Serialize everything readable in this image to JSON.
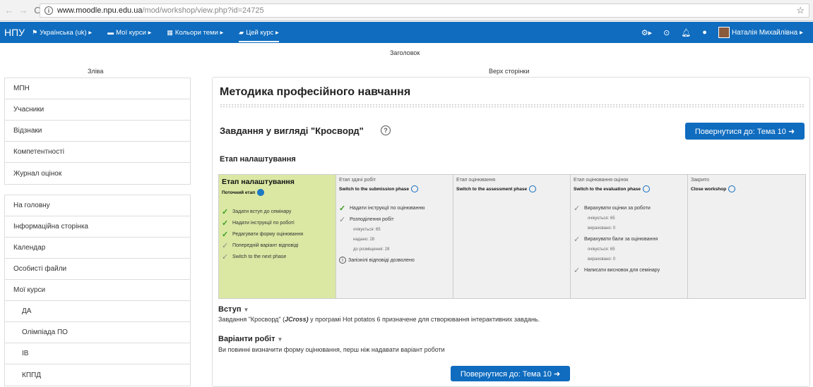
{
  "browser": {
    "url_host": "www.moodle.npu.edu.ua",
    "url_path": "/mod/workshop/view.php?id=24725"
  },
  "navbar": {
    "brand": "НПУ",
    "items": [
      {
        "label": "Українська (uk) ▸",
        "icon": "flag-icon"
      },
      {
        "label": "Мої курси ▸",
        "icon": "briefcase-icon"
      },
      {
        "label": "Кольори теми ▸",
        "icon": "grid-icon"
      },
      {
        "label": "Цей курс ▸",
        "icon": "book-icon"
      }
    ],
    "user_name": "Наталія Михайлівна ▸"
  },
  "regions": {
    "header": "Заголовок",
    "left": "Зліва",
    "top": "Верх сторінки"
  },
  "left_block_1": [
    "МПН",
    "Учасники",
    "Відзнаки",
    "Компетентності",
    "Журнал оцінок"
  ],
  "left_block_2": [
    "На головну",
    "Інформаційна сторінка",
    "Календар",
    "Особисті файли",
    "Мої курси",
    "ДА",
    "Олімпіада ПО",
    "ІВ",
    "КППД"
  ],
  "main": {
    "course_title": "Методика професійного навчання",
    "activity_title": "Завдання у вигляді \"Кросворд\"",
    "return_button": "Повернутися до: Тема 10 ➜",
    "stage_heading": "Етап налаштування"
  },
  "phases": [
    {
      "title": "Етап налаштування",
      "action": "Поточний етап",
      "current": true,
      "tasks": [
        {
          "type": "done",
          "text": "Задати вступ до семінару"
        },
        {
          "type": "done",
          "text": "Надати інструкції по роботі"
        },
        {
          "type": "done",
          "text": "Редагувати форму оцінювання"
        },
        {
          "type": "todo",
          "text": "Попередній варіант відповіді"
        },
        {
          "type": "todo",
          "text": "Switch to the next phase"
        }
      ]
    },
    {
      "title": "Етап здачі робіт",
      "action": "Switch to the submission phase",
      "current": false,
      "tasks": [
        {
          "type": "done",
          "text": "Надати інструкції по оцінюванню"
        },
        {
          "type": "todo",
          "text": "Розподілення робіт"
        },
        {
          "type": "detail",
          "text": "очікується: 65"
        },
        {
          "type": "detail",
          "text": "надано: 28"
        },
        {
          "type": "detail",
          "text": "до розміщення: 28"
        },
        {
          "type": "info",
          "text": "Запізнілі відповіді дозволено"
        }
      ]
    },
    {
      "title": "Етап оцінювання",
      "action": "Switch to the assessment phase",
      "current": false,
      "tasks": []
    },
    {
      "title": "Етап оцінювання оцінок",
      "action": "Switch to the evaluation phase",
      "current": false,
      "tasks": [
        {
          "type": "todo",
          "text": "Вирахувати оцінки за роботи"
        },
        {
          "type": "detail",
          "text": "очікується: 65"
        },
        {
          "type": "detail",
          "text": "вираховано: 0"
        },
        {
          "type": "todo",
          "text": "Вирахувати бали за оцінювання"
        },
        {
          "type": "detail",
          "text": "очікується: 65"
        },
        {
          "type": "detail",
          "text": "вираховано: 0"
        },
        {
          "type": "todo",
          "text": "Написати висновок для семінару"
        }
      ]
    },
    {
      "title": "Закрито",
      "action": "Close workshop",
      "current": false,
      "tasks": []
    }
  ],
  "intro": {
    "title": "Вступ",
    "text_before": "Завдання \"Кросворд\" (",
    "text_em": "JCross)",
    "text_after": " у програмі Hot potatos 6 призначене для створювання інтерактивних завдань."
  },
  "submissions": {
    "title": "Варіанти робіт",
    "text": "Ви повинні визначити форму оцінювання, перш ніж надавати варіант роботи"
  }
}
